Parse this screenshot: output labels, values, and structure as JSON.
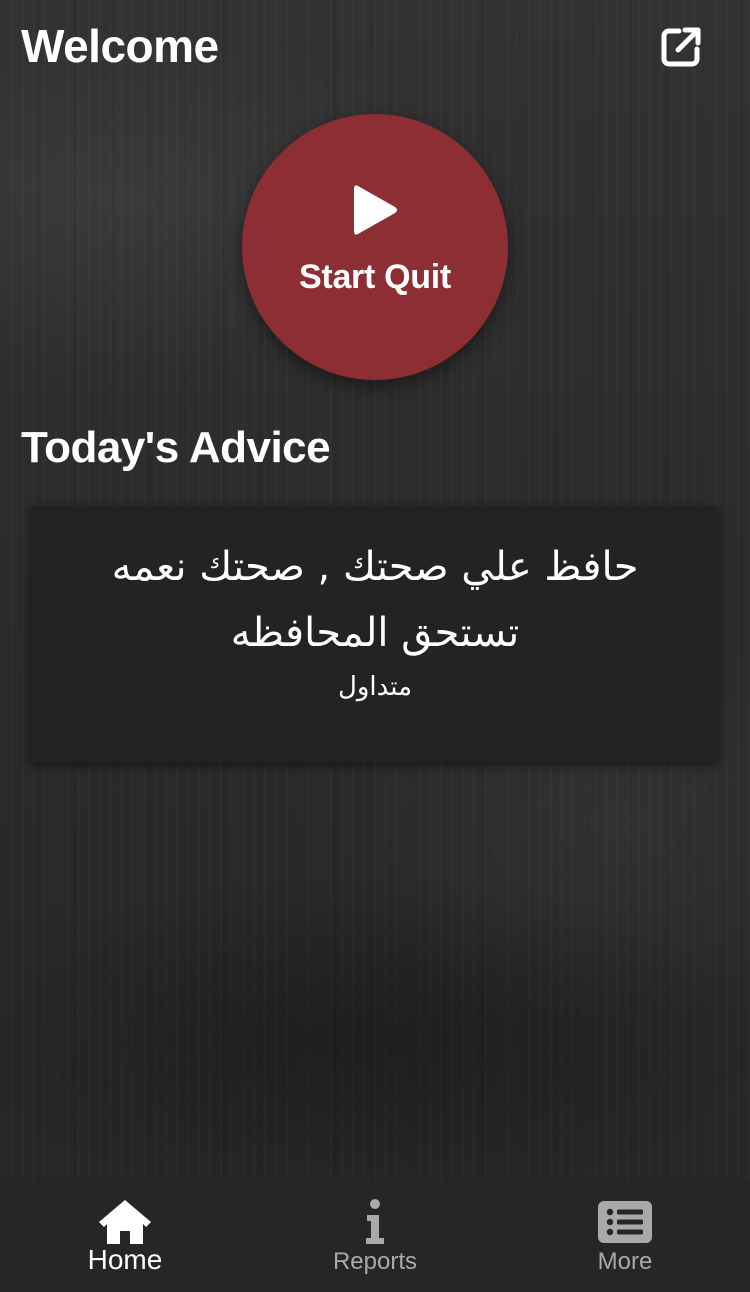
{
  "header": {
    "title": "Welcome",
    "share_icon": "external-link-icon"
  },
  "start_button": {
    "label": "Start Quit",
    "icon": "play-icon",
    "color": "#8c2e33"
  },
  "advice": {
    "section_title": "Today's Advice",
    "quote": "حافظ علي صحتك , صحتك نعمه تستحق المحافظه",
    "author": "متداول"
  },
  "bottom_nav": {
    "items": [
      {
        "label": "Home",
        "icon": "home-icon",
        "active": true
      },
      {
        "label": "Reports",
        "icon": "info-icon",
        "active": false
      },
      {
        "label": "More",
        "icon": "list-icon",
        "active": false
      }
    ]
  }
}
